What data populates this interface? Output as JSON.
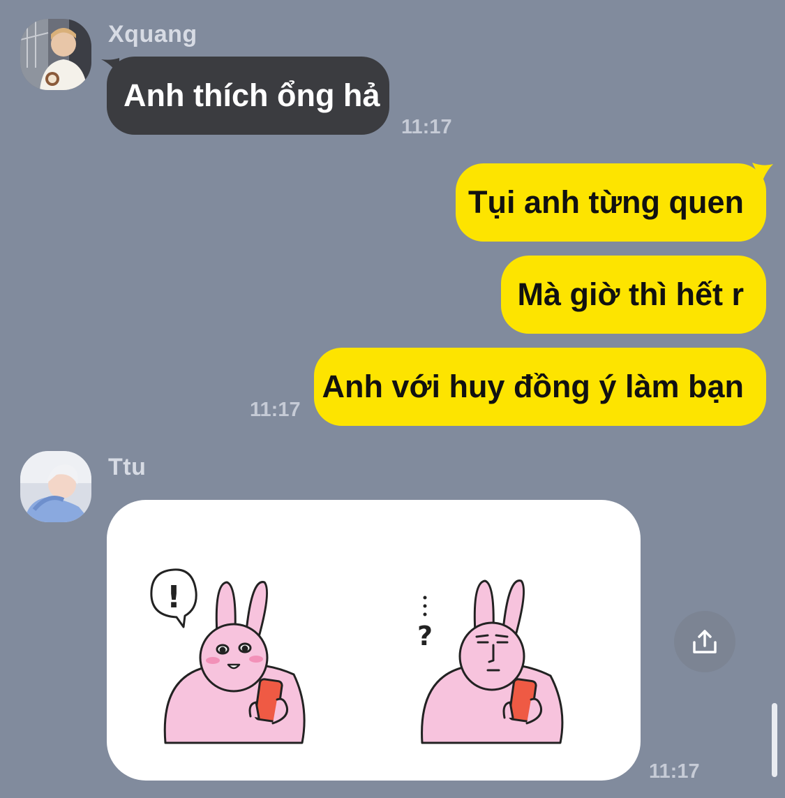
{
  "messages": {
    "m1": {
      "sender": "Xquang",
      "text": "Anh thích ổng hả",
      "time": "11:17"
    },
    "outgoing": {
      "texts": [
        "Tụi anh từng quen",
        "Mà giờ thì hết r",
        "Anh với huy đồng ý làm bạn"
      ],
      "time": "11:17"
    },
    "m3": {
      "sender": "Ttu",
      "sticker_left_mark": "!",
      "sticker_right_mark": "?",
      "time": "11:17"
    }
  },
  "colors": {
    "background": "#818b9d",
    "incoming_bubble": "#3b3c40",
    "outgoing_bubble": "#fde400",
    "sticker_pink": "#f7c3dd",
    "phone_red": "#ef5a44"
  },
  "icons": {
    "share": "share-icon"
  }
}
